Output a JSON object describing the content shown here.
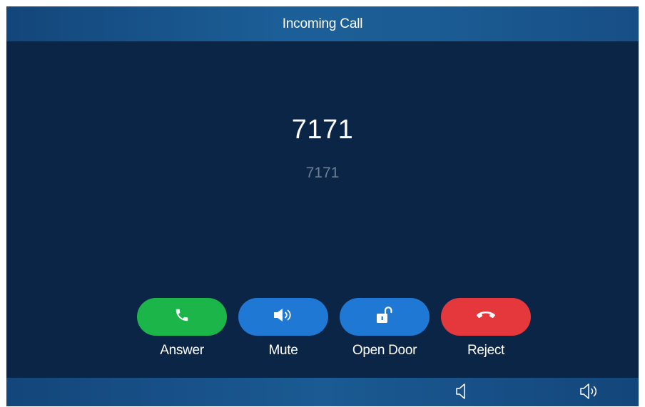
{
  "header": {
    "title": "Incoming Call"
  },
  "caller": {
    "number": "7171",
    "subtitle": "7171"
  },
  "actions": [
    {
      "label": "Answer",
      "icon": "phone-icon",
      "color": "#1cb54a"
    },
    {
      "label": "Mute",
      "icon": "speaker-icon",
      "color": "#1e78d4"
    },
    {
      "label": "Open Door",
      "icon": "unlock-icon",
      "color": "#1e78d4"
    },
    {
      "label": "Reject",
      "icon": "hangup-icon",
      "color": "#e5383d"
    }
  ],
  "footer": {
    "volume_down_icon": "volume-down-icon",
    "volume_up_icon": "volume-up-icon"
  },
  "colors": {
    "background": "#0b2546",
    "bar": "#1b5a93",
    "answer": "#1cb54a",
    "neutral": "#1e78d4",
    "reject": "#e5383d",
    "subtitle": "#6e7f96"
  }
}
